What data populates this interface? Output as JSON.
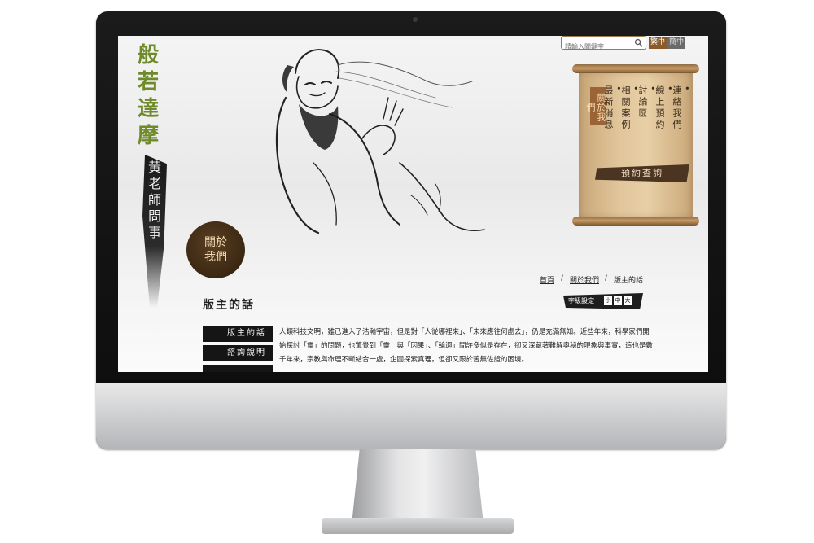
{
  "brand": {
    "title": "般若達摩",
    "subtitle": "黃老師問事",
    "about_badge": "關於我們"
  },
  "header": {
    "search_placeholder": "請輸入關鍵字",
    "lang_trad": "繁中",
    "lang_simp": "簡中"
  },
  "scroll_menu": {
    "active": "關於我們",
    "items": [
      "連絡我們",
      "線上預約",
      "討論區",
      "相關案例",
      "最新消息"
    ],
    "reserve_button": "預約查詢"
  },
  "breadcrumb": {
    "home": "首頁",
    "sep": "/",
    "section": "關於我們",
    "current": "版主的話"
  },
  "font_size": {
    "label": "字級設定",
    "small": "小",
    "medium": "中",
    "large": "大"
  },
  "page_title": "版主的話",
  "sidebar": [
    "版主的話",
    "諮詢說明"
  ],
  "content": "人類科技文明，雖已進入了浩瀚宇宙，但是對「人從哪裡來」、「未來應往何處去」，仍是充滿無知。近些年來，科學家們開始探討「靈」的問題，也驚覺到「靈」與「因果」、「輪迴」間許多似是存在，卻又深藏著難解奧秘的現象與事實，這也是數千年來，宗教與命理不斷結合一處，企圖探索真理，但卻又限於苦無佐證的困境。",
  "colors": {
    "brand_green": "#6f8a2a",
    "accent_brown": "#8a5a2a",
    "scroll_paper": "#e1c59b"
  }
}
